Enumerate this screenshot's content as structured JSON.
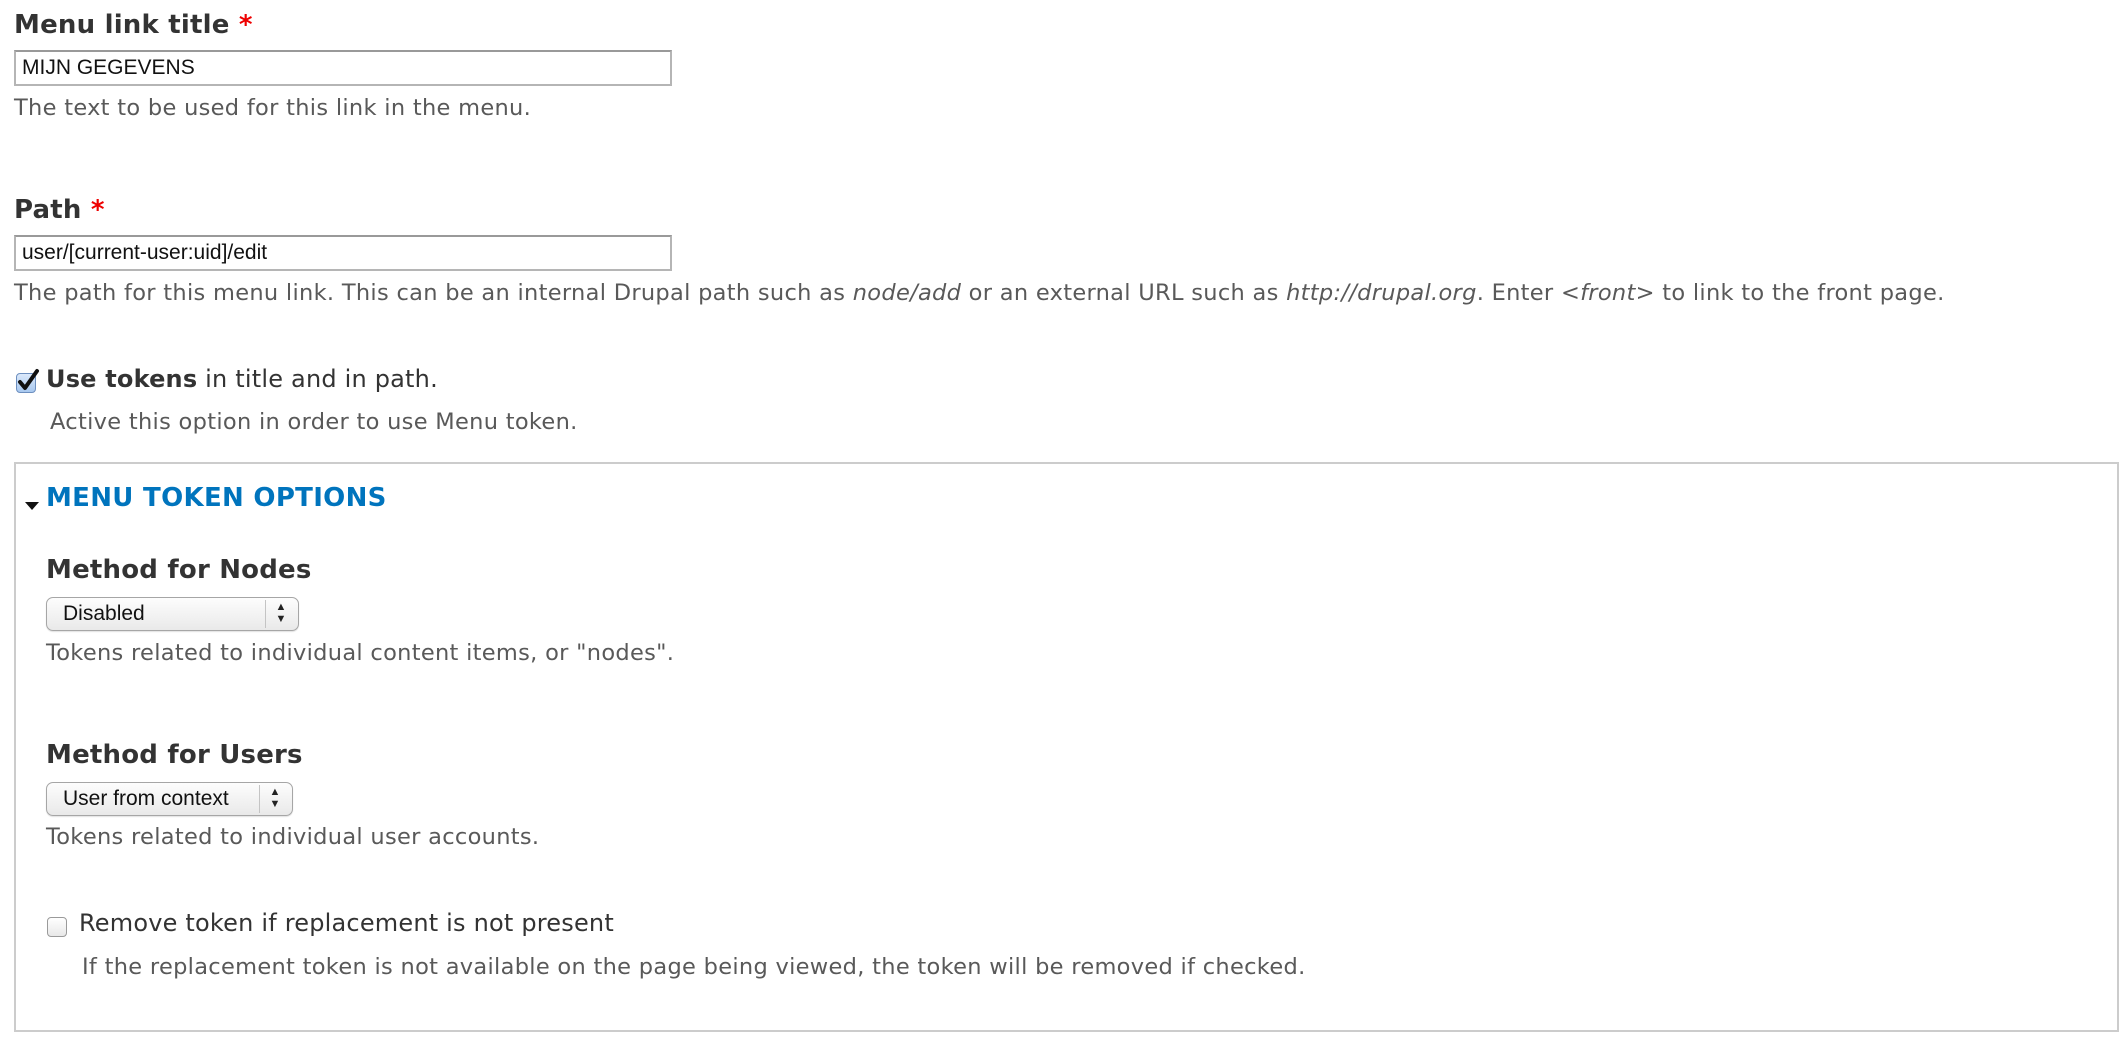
{
  "menu_link_title": {
    "label": "Menu link title",
    "required_marker": "*",
    "value": "MIJN GEGEVENS",
    "description": "The text to be used for this link in the menu."
  },
  "path": {
    "label": "Path",
    "required_marker": "*",
    "value": "user/[current-user:uid]/edit",
    "description": {
      "part1": "The path for this menu link. This can be an internal Drupal path such as ",
      "em1": "node/add",
      "part2": " or an external URL such as ",
      "em2": "http://drupal.org",
      "part3": ". Enter ",
      "em3": "<front>",
      "part4": " to link to the front page."
    }
  },
  "use_tokens": {
    "checked": true,
    "label_bold": "Use tokens",
    "label_rest": " in title and in path.",
    "description": "Active this option in order to use Menu token."
  },
  "fieldset": {
    "legend": "MENU TOKEN OPTIONS",
    "expanded": true,
    "accent_color": "#0074bd",
    "nodes": {
      "label": "Method for Nodes",
      "selected": "Disabled",
      "description": "Tokens related to individual content items, or \"nodes\"."
    },
    "users": {
      "label": "Method for Users",
      "selected": "User from context",
      "description": "Tokens related to individual user accounts."
    },
    "remove_token": {
      "checked": false,
      "label": "Remove token if replacement is not present",
      "description": "If the replacement token is not available on the page being viewed, the token will be removed if checked."
    }
  }
}
